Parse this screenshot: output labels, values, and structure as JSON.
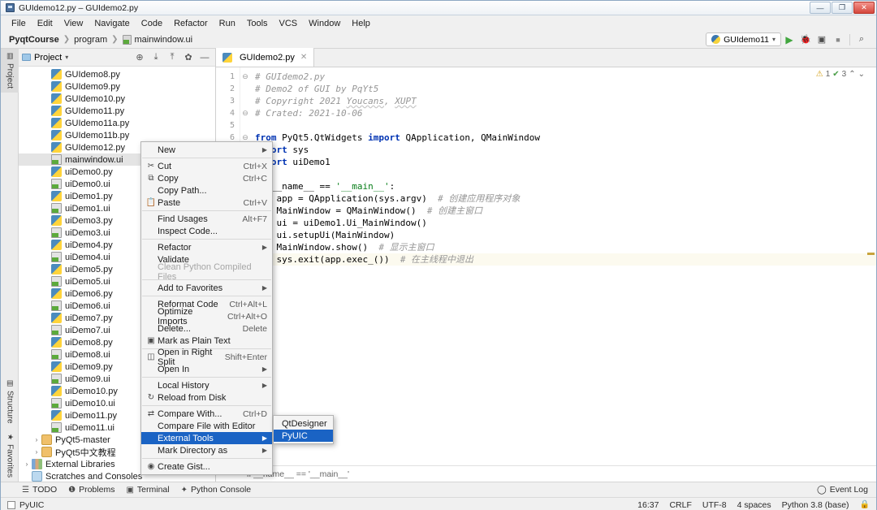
{
  "window": {
    "title": "GUIdemo12.py – GUIdemo2.py",
    "icon": "app-icon",
    "controls": {
      "minimize": "—",
      "maximize": "❐",
      "close": "✕"
    }
  },
  "menubar": [
    "File",
    "Edit",
    "View",
    "Navigate",
    "Code",
    "Refactor",
    "Run",
    "Tools",
    "VCS",
    "Window",
    "Help"
  ],
  "breadcrumb": {
    "project": "PyqtCourse",
    "folder": "program",
    "file": "mainwindow.ui"
  },
  "run_toolbar": {
    "config": "GUIdemo11",
    "caret": "▾",
    "buttons": [
      "run",
      "debug",
      "run-with-coverage",
      "stop",
      "search"
    ],
    "glyphs": {
      "run": "▶",
      "debug": "🐞",
      "coverage": "▣",
      "stop": "■",
      "search": "⌕"
    }
  },
  "left_rail": [
    {
      "label": "Project",
      "icon": "project-icon",
      "glyph": "▤",
      "active": true
    },
    {
      "label": "Structure",
      "icon": "structure-icon",
      "glyph": "▥",
      "active": false
    },
    {
      "label": "Favorites",
      "icon": "star-icon",
      "glyph": "★",
      "active": false
    }
  ],
  "project_panel": {
    "title": "Project",
    "caret": "▾",
    "tools": [
      {
        "name": "locate-icon",
        "glyph": "⊕"
      },
      {
        "name": "expand-all-icon",
        "glyph": "⤓"
      },
      {
        "name": "collapse-all-icon",
        "glyph": "⤒"
      },
      {
        "name": "settings-gear-icon",
        "glyph": "✿"
      },
      {
        "name": "hide-panel-icon",
        "glyph": "—"
      }
    ],
    "tree": [
      {
        "label": "GUIdemo8.py",
        "type": "py",
        "indent": 2,
        "selected": false
      },
      {
        "label": "GUIdemo9.py",
        "type": "py",
        "indent": 2,
        "selected": false
      },
      {
        "label": "GUIdemo10.py",
        "type": "py",
        "indent": 2,
        "selected": false
      },
      {
        "label": "GUIdemo11.py",
        "type": "py",
        "indent": 2,
        "selected": false
      },
      {
        "label": "GUIdemo11a.py",
        "type": "py",
        "indent": 2,
        "selected": false
      },
      {
        "label": "GUIdemo11b.py",
        "type": "py",
        "indent": 2,
        "selected": false
      },
      {
        "label": "GUIdemo12.py",
        "type": "py",
        "indent": 2,
        "selected": false
      },
      {
        "label": "mainwindow.ui",
        "type": "ui",
        "indent": 2,
        "selected": true
      },
      {
        "label": "uiDemo0.py",
        "type": "py",
        "indent": 2,
        "selected": false
      },
      {
        "label": "uiDemo0.ui",
        "type": "ui",
        "indent": 2,
        "selected": false
      },
      {
        "label": "uiDemo1.py",
        "type": "py",
        "indent": 2,
        "selected": false
      },
      {
        "label": "uiDemo1.ui",
        "type": "ui",
        "indent": 2,
        "selected": false
      },
      {
        "label": "uiDemo3.py",
        "type": "py",
        "indent": 2,
        "selected": false
      },
      {
        "label": "uiDemo3.ui",
        "type": "ui",
        "indent": 2,
        "selected": false
      },
      {
        "label": "uiDemo4.py",
        "type": "py",
        "indent": 2,
        "selected": false
      },
      {
        "label": "uiDemo4.ui",
        "type": "ui",
        "indent": 2,
        "selected": false
      },
      {
        "label": "uiDemo5.py",
        "type": "py",
        "indent": 2,
        "selected": false
      },
      {
        "label": "uiDemo5.ui",
        "type": "ui",
        "indent": 2,
        "selected": false
      },
      {
        "label": "uiDemo6.py",
        "type": "py",
        "indent": 2,
        "selected": false
      },
      {
        "label": "uiDemo6.ui",
        "type": "ui",
        "indent": 2,
        "selected": false
      },
      {
        "label": "uiDemo7.py",
        "type": "py",
        "indent": 2,
        "selected": false
      },
      {
        "label": "uiDemo7.ui",
        "type": "ui",
        "indent": 2,
        "selected": false
      },
      {
        "label": "uiDemo8.py",
        "type": "py",
        "indent": 2,
        "selected": false
      },
      {
        "label": "uiDemo8.ui",
        "type": "ui",
        "indent": 2,
        "selected": false
      },
      {
        "label": "uiDemo9.py",
        "type": "py",
        "indent": 2,
        "selected": false
      },
      {
        "label": "uiDemo9.ui",
        "type": "ui",
        "indent": 2,
        "selected": false
      },
      {
        "label": "uiDemo10.py",
        "type": "py",
        "indent": 2,
        "selected": false
      },
      {
        "label": "uiDemo10.ui",
        "type": "ui",
        "indent": 2,
        "selected": false
      },
      {
        "label": "uiDemo11.py",
        "type": "py",
        "indent": 2,
        "selected": false
      },
      {
        "label": "uiDemo11.ui",
        "type": "ui",
        "indent": 2,
        "selected": false
      },
      {
        "label": "PyQt5-master",
        "type": "dir",
        "indent": 1,
        "selected": false,
        "arrow": "›"
      },
      {
        "label": "PyQt5中文教程",
        "type": "dir",
        "indent": 1,
        "selected": false,
        "arrow": "›"
      },
      {
        "label": "External Libraries",
        "type": "lib",
        "indent": 0,
        "selected": false,
        "arrow": "›"
      },
      {
        "label": "Scratches and Consoles",
        "type": "scratch",
        "indent": 0,
        "selected": false
      }
    ]
  },
  "editor": {
    "tab": {
      "label": "GUIdemo2.py",
      "close": "✕",
      "icon": "python-file-icon"
    },
    "inspections": {
      "warning_count": "1",
      "ok_count": "3",
      "warn_glyph": "⚠",
      "ok_glyph": "✔",
      "up": "⌃",
      "down": "⌄"
    },
    "breadcrumb": "if __name__ == '__main__'",
    "lines": [
      {
        "n": "1",
        "fold": "⊖",
        "html": "<span class='cmt'># GUIdemo2.py</span>"
      },
      {
        "n": "2",
        "fold": "",
        "html": "<span class='cmt'># Demo2 of GUI by PqYt5</span>"
      },
      {
        "n": "3",
        "fold": "",
        "html": "<span class='cmt'># Copyright 2021 <span class='typo'>Youcans</span>, <span class='typo'>XUPT</span></span>"
      },
      {
        "n": "4",
        "fold": "⊖",
        "html": "<span class='cmt'># Crated: 2021-10-06</span>"
      },
      {
        "n": "5",
        "fold": "",
        "html": ""
      },
      {
        "n": "6",
        "fold": "⊖",
        "html": "<span class='kw'>from</span> PyQt5.QtWidgets <span class='kw'>import</span> QApplication, QMainWindow"
      },
      {
        "n": "7",
        "fold": "",
        "html": "<span class='kw'>import</span> sys"
      },
      {
        "n": "8",
        "fold": "⊖",
        "html": "<span class='kw'>import</span> uiDemo1"
      },
      {
        "n": "9",
        "fold": "",
        "html": ""
      },
      {
        "n": "10",
        "fold": "⊖",
        "html": "<span class='kw'>if</span> __name__ == <span class='str'>'__main__'</span>:"
      },
      {
        "n": "11",
        "fold": "",
        "html": "    app = QApplication(sys.argv)  <span class='cmt'># 创建应用程序对象</span>"
      },
      {
        "n": "12",
        "fold": "",
        "html": "    MainWindow = QMainWindow()  <span class='cmt'># 创建主窗口</span>"
      },
      {
        "n": "13",
        "fold": "",
        "html": "    ui = uiDemo1.Ui_MainWindow()"
      },
      {
        "n": "14",
        "fold": "",
        "html": "    ui.setupUi(MainWindow)"
      },
      {
        "n": "15",
        "fold": "",
        "html": "    MainWindow.show()  <span class='cmt'># 显示主窗口</span>"
      },
      {
        "n": "16",
        "fold": "",
        "html": "    sys.exit(app.exec_())  <span class='cmt'># 在主线程中退出</span>",
        "current": true
      }
    ]
  },
  "context_menu": {
    "items": [
      {
        "label": "New",
        "mnemonic": "",
        "icon": "",
        "glyph": "",
        "shortcut": "",
        "submenu": true
      },
      {
        "sep": true
      },
      {
        "label": "Cut",
        "mnemonic": "u",
        "icon": "scissors-icon",
        "glyph": "✂",
        "shortcut": "Ctrl+X"
      },
      {
        "label": "Copy",
        "mnemonic": "C",
        "icon": "copy-icon",
        "glyph": "⧉",
        "shortcut": "Ctrl+C"
      },
      {
        "label": "Copy Path...",
        "icon": "",
        "glyph": "",
        "shortcut": ""
      },
      {
        "label": "Paste",
        "mnemonic": "P",
        "icon": "clipboard-icon",
        "glyph": "📋",
        "shortcut": "Ctrl+V"
      },
      {
        "sep": true
      },
      {
        "label": "Find Usages",
        "mnemonic": "U",
        "icon": "",
        "glyph": "",
        "shortcut": "Alt+F7"
      },
      {
        "label": "Inspect Code...",
        "mnemonic": "I",
        "icon": "",
        "glyph": "",
        "shortcut": ""
      },
      {
        "sep": true
      },
      {
        "label": "Refactor",
        "mnemonic": "R",
        "icon": "",
        "glyph": "",
        "shortcut": "",
        "submenu": true
      },
      {
        "label": "Validate",
        "mnemonic": "V",
        "icon": "",
        "glyph": "",
        "shortcut": ""
      },
      {
        "label": "Clean Python Compiled Files",
        "icon": "",
        "glyph": "",
        "shortcut": "",
        "disabled": true
      },
      {
        "sep": true
      },
      {
        "label": "Add to Favorites",
        "mnemonic": "v",
        "icon": "",
        "glyph": "",
        "shortcut": "",
        "submenu": true
      },
      {
        "sep": true
      },
      {
        "label": "Reformat Code",
        "mnemonic": "R",
        "icon": "",
        "glyph": "",
        "shortcut": "Ctrl+Alt+L"
      },
      {
        "label": "Optimize Imports",
        "mnemonic": "z",
        "icon": "",
        "glyph": "",
        "shortcut": "Ctrl+Alt+O"
      },
      {
        "label": "Delete...",
        "mnemonic": "D",
        "icon": "",
        "glyph": "",
        "shortcut": "Delete"
      },
      {
        "label": "Mark as Plain Text",
        "icon": "plain-text-icon",
        "glyph": "▣",
        "shortcut": ""
      },
      {
        "sep": true
      },
      {
        "label": "Open in Right Split",
        "icon": "split-icon",
        "glyph": "◫",
        "shortcut": "Shift+Enter"
      },
      {
        "label": "Open In",
        "icon": "",
        "glyph": "",
        "shortcut": "",
        "submenu": true
      },
      {
        "sep": true
      },
      {
        "label": "Local History",
        "mnemonic": "H",
        "icon": "",
        "glyph": "",
        "shortcut": "",
        "submenu": true
      },
      {
        "label": "Reload from Disk",
        "icon": "reload-icon",
        "glyph": "↻",
        "shortcut": ""
      },
      {
        "sep": true
      },
      {
        "label": "Compare With...",
        "icon": "compare-icon",
        "glyph": "⇄",
        "shortcut": "Ctrl+D"
      },
      {
        "label": "Compare File with Editor",
        "mnemonic": "p",
        "icon": "",
        "glyph": "",
        "shortcut": ""
      },
      {
        "label": "External Tools",
        "icon": "",
        "glyph": "",
        "shortcut": "",
        "submenu": true,
        "highlighted": true
      },
      {
        "label": "Mark Directory as",
        "icon": "",
        "glyph": "",
        "shortcut": "",
        "submenu": true
      },
      {
        "sep": true
      },
      {
        "label": "Create Gist...",
        "icon": "github-icon",
        "glyph": "◉",
        "shortcut": ""
      }
    ],
    "submenu": {
      "items": [
        {
          "label": "QtDesigner",
          "highlighted": false
        },
        {
          "label": "PyUIC",
          "highlighted": true
        }
      ]
    }
  },
  "tool_windows": [
    {
      "label": "TODO",
      "icon": "todo-icon",
      "glyph": "☰"
    },
    {
      "label": "Problems",
      "icon": "problems-icon",
      "glyph": "❶"
    },
    {
      "label": "Terminal",
      "icon": "terminal-icon",
      "glyph": "▣"
    },
    {
      "label": "Python Console",
      "icon": "python-console-icon",
      "glyph": "✦"
    }
  ],
  "event_log": {
    "label": "Event Log",
    "icon": "bell-icon",
    "glyph": "◯"
  },
  "statusbar": {
    "task": "PyUIC",
    "task_icon": "process-icon",
    "time": "16:37",
    "line_separator": "CRLF",
    "encoding": "UTF-8",
    "indent": "4 spaces",
    "interpreter": "Python 3.8 (base)",
    "lock_icon": "lock-icon",
    "lock_glyph": "🔒"
  },
  "colors": {
    "accent": "#1a63c4",
    "selection": "#e4e4e4",
    "current_line": "#fcfaef",
    "keyword": "#0033b3",
    "string": "#067d17",
    "comment": "#969696"
  }
}
